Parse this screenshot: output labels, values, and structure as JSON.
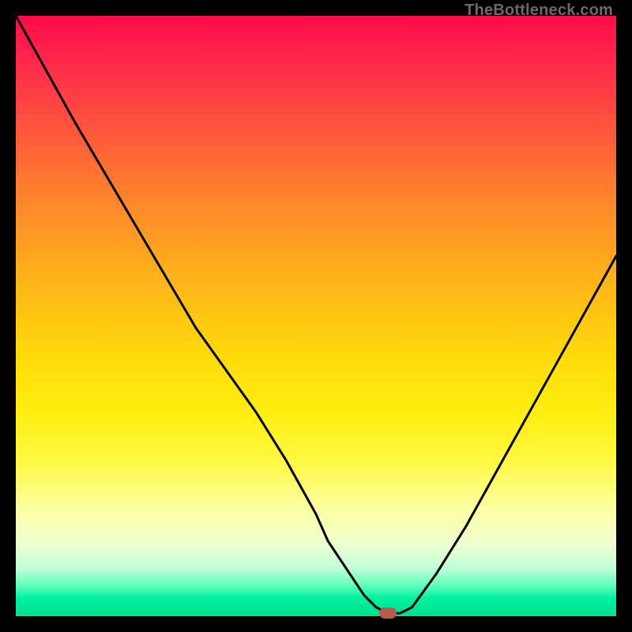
{
  "watermark": "TheBottleneck.com",
  "chart_data": {
    "type": "line",
    "title": "",
    "xlabel": "",
    "ylabel": "",
    "xlim": [
      0,
      100
    ],
    "ylim": [
      0,
      100
    ],
    "x": [
      0,
      5,
      10,
      15,
      20,
      25,
      30,
      35,
      40,
      45,
      50,
      52,
      55,
      58,
      60,
      62,
      64,
      66,
      70,
      75,
      80,
      85,
      90,
      95,
      100
    ],
    "values": [
      100,
      91,
      82,
      73.5,
      65,
      56.5,
      48,
      41,
      34,
      26,
      17,
      12.5,
      8,
      3.5,
      1.5,
      0.5,
      0.5,
      1.5,
      7,
      15,
      24,
      33,
      42,
      51,
      60
    ],
    "marker": {
      "x": 62,
      "y": 0.5
    },
    "background_gradient": {
      "top": "#ff0a4a",
      "mid": "#ffee10",
      "bottom": "#00e090"
    }
  }
}
